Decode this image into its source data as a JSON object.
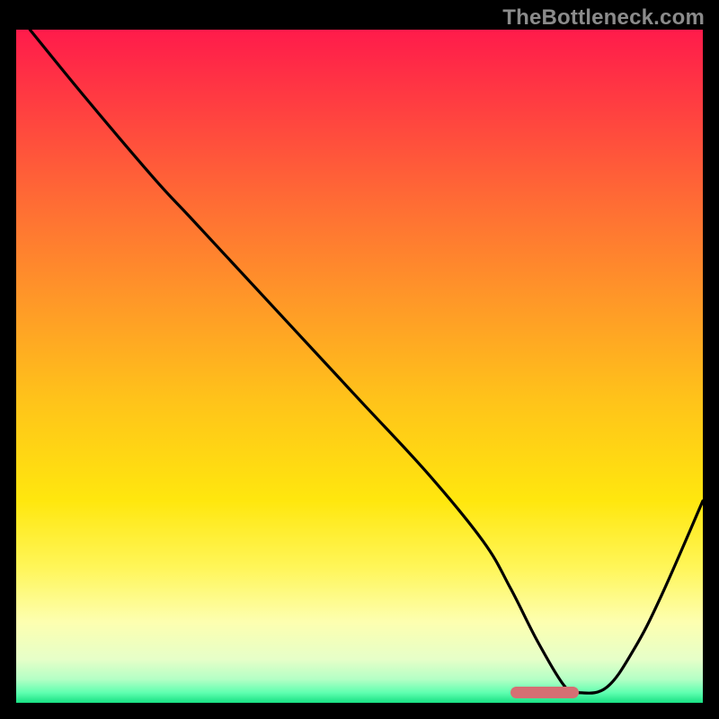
{
  "watermark": "TheBottleneck.com",
  "colors": {
    "black": "#000000",
    "watermark": "#8b8b8b",
    "marker": "#d56f73",
    "curve": "#000000",
    "gradient_stops": [
      {
        "offset": 0.0,
        "color": "#ff1b4b"
      },
      {
        "offset": 0.1,
        "color": "#ff3a42"
      },
      {
        "offset": 0.25,
        "color": "#ff6a35"
      },
      {
        "offset": 0.4,
        "color": "#ff9728"
      },
      {
        "offset": 0.55,
        "color": "#ffc31a"
      },
      {
        "offset": 0.7,
        "color": "#ffe70e"
      },
      {
        "offset": 0.8,
        "color": "#fff65a"
      },
      {
        "offset": 0.88,
        "color": "#fdffb0"
      },
      {
        "offset": 0.935,
        "color": "#e6ffc8"
      },
      {
        "offset": 0.965,
        "color": "#b4ffc5"
      },
      {
        "offset": 0.985,
        "color": "#5fffb0"
      },
      {
        "offset": 1.0,
        "color": "#18e083"
      }
    ]
  },
  "chart_data": {
    "type": "line",
    "title": "",
    "xlabel": "",
    "ylabel": "",
    "xlim": [
      0,
      100
    ],
    "ylim": [
      0,
      100
    ],
    "grid": false,
    "series": [
      {
        "name": "bottleneck-curve",
        "x": [
          2,
          10,
          20,
          25,
          30,
          40,
          50,
          60,
          68,
          72,
          76,
          80,
          82,
          86,
          90,
          94,
          100
        ],
        "y": [
          100,
          90,
          78,
          72.5,
          67,
          56,
          45,
          34,
          24,
          17,
          9,
          2.3,
          1.5,
          2.3,
          8,
          16,
          30
        ]
      }
    ],
    "annotations": [
      {
        "name": "optimal-range",
        "x_start": 72,
        "x_end": 82,
        "y": 1.6
      }
    ],
    "legend": false
  }
}
